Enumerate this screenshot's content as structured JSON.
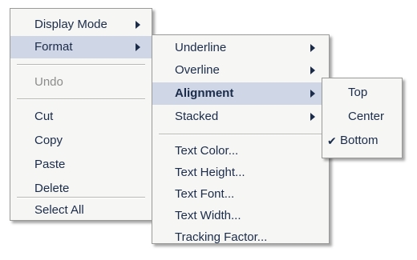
{
  "menu1": {
    "items": [
      {
        "label": "Display Mode"
      },
      {
        "label": "Format"
      },
      {
        "label": "Undo"
      },
      {
        "label": "Cut"
      },
      {
        "label": "Copy"
      },
      {
        "label": "Paste"
      },
      {
        "label": "Delete"
      },
      {
        "label": "Select All"
      }
    ]
  },
  "menu2": {
    "items": [
      {
        "label": "Underline"
      },
      {
        "label": "Overline"
      },
      {
        "label": "Alignment"
      },
      {
        "label": "Stacked"
      },
      {
        "label": "Text Color..."
      },
      {
        "label": "Text Height..."
      },
      {
        "label": "Text Font..."
      },
      {
        "label": "Text Width..."
      },
      {
        "label": "Tracking Factor..."
      }
    ]
  },
  "menu3": {
    "items": [
      {
        "label": "Top"
      },
      {
        "label": "Center"
      },
      {
        "label": "Bottom"
      }
    ],
    "checked_label": "Bottom"
  },
  "colors": {
    "highlight": "#cfd6e6",
    "text": "#1b2c4a",
    "disabled_text": "#8c8c8c"
  },
  "icons": [
    "submenu-arrow-icon",
    "checkmark-icon"
  ]
}
